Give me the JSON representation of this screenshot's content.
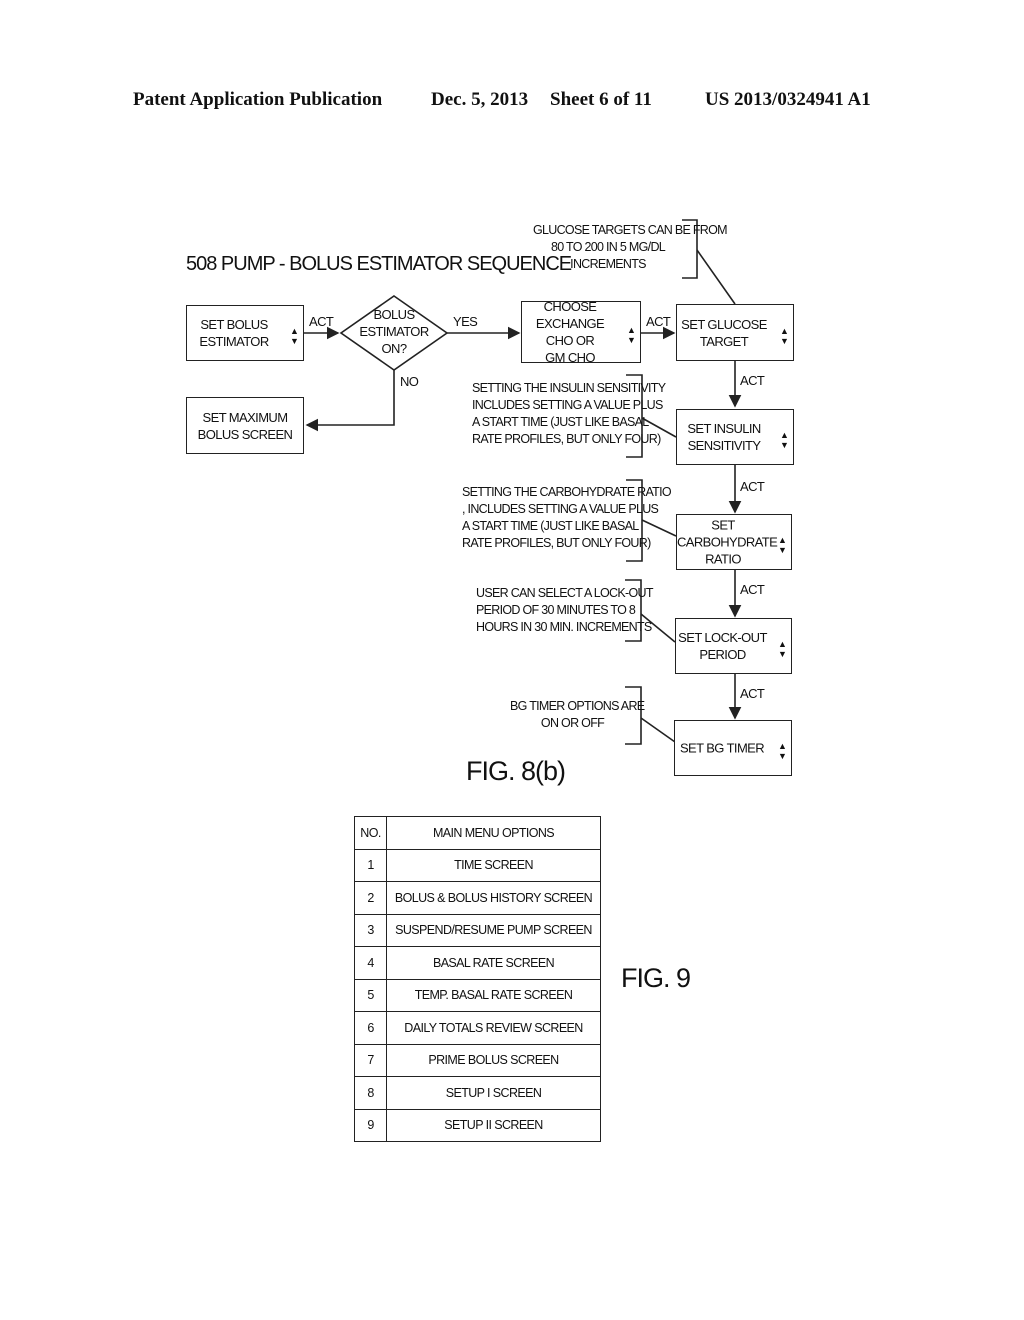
{
  "header": {
    "publication": "Patent Application Publication",
    "date": "Dec. 5, 2013",
    "sheet": "Sheet 6 of 11",
    "number": "US 2013/0324941 A1"
  },
  "fig8b": {
    "title": "508 PUMP - BOLUS ESTIMATOR SEQUENCE",
    "caption": "FIG. 8(b)",
    "boxes": {
      "set_bolus_estimator": [
        "SET BOLUS",
        "ESTIMATOR"
      ],
      "set_maximum_bolus": [
        "SET MAXIMUM",
        "BOLUS SCREEN"
      ],
      "choose_exchange": [
        "CHOOSE EXCHANGE",
        "CHO OR",
        "GM CHO"
      ],
      "set_glucose_target": [
        "SET GLUCOSE",
        "TARGET"
      ],
      "set_insulin_sensitivity": [
        "SET INSULIN",
        "SENSITIVITY"
      ],
      "set_carbohydrate_ratio": [
        "SET CARBOHYDRATE",
        "RATIO"
      ],
      "set_lockout_period": [
        "SET LOCK-OUT",
        "PERIOD"
      ],
      "set_bg_timer": [
        "SET BG TIMER"
      ]
    },
    "decision": [
      "BOLUS",
      "ESTIMATOR",
      "ON?"
    ],
    "edge_labels": {
      "act": "ACT",
      "yes": "YES",
      "no": "NO"
    },
    "updown_symbol": "▲\n▼",
    "notes": {
      "glucose_targets": [
        "GLUCOSE TARGETS CAN BE FROM",
        "80 TO 200 IN 5 MG/DL",
        "INCREMENTS"
      ],
      "insulin_sensitivity": [
        "SETTING THE INSULIN SENSITIVITY",
        "INCLUDES SETTING A VALUE PLUS",
        "A START TIME (JUST LIKE  BASAL",
        "RATE PROFILES, BUT ONLY FOUR)"
      ],
      "carbohydrate_ratio": [
        "SETTING THE CARBOHYDRATE RATIO",
        ", INCLUDES SETTING A VALUE PLUS",
        "A START TIME (JUST LIKE  BASAL",
        "RATE PROFILES, BUT ONLY FOUR)"
      ],
      "lockout": [
        "USER CAN SELECT A LOCK-OUT",
        "PERIOD OF 30 MINUTES TO 8",
        "HOURS IN 30 MIN. INCREMENTS"
      ],
      "bg_timer": [
        "BG TIMER OPTIONS ARE",
        "ON OR OFF"
      ]
    }
  },
  "fig9": {
    "caption": "FIG. 9",
    "headers": [
      "NO.",
      "MAIN MENU OPTIONS"
    ],
    "rows": [
      {
        "no": "1",
        "option": "TIME SCREEN"
      },
      {
        "no": "2",
        "option": "BOLUS & BOLUS HISTORY SCREEN"
      },
      {
        "no": "3",
        "option": "SUSPEND/RESUME PUMP SCREEN"
      },
      {
        "no": "4",
        "option": "BASAL RATE SCREEN"
      },
      {
        "no": "5",
        "option": "TEMP. BASAL RATE SCREEN"
      },
      {
        "no": "6",
        "option": "DAILY TOTALS REVIEW SCREEN"
      },
      {
        "no": "7",
        "option": "PRIME BOLUS SCREEN"
      },
      {
        "no": "8",
        "option": "SETUP I SCREEN"
      },
      {
        "no": "9",
        "option": "SETUP II SCREEN"
      }
    ]
  }
}
